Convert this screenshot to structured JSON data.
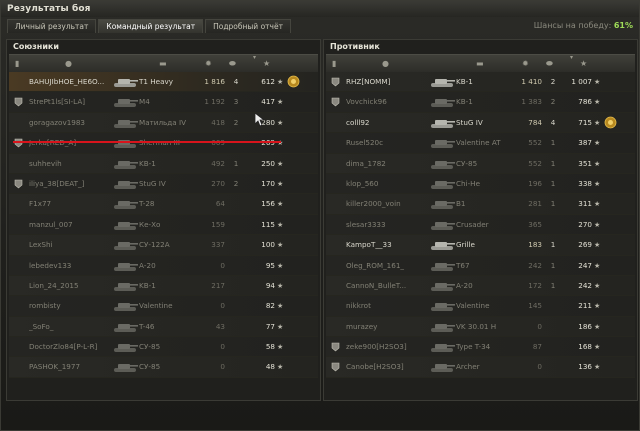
{
  "window": {
    "title": "Результаты боя"
  },
  "tabs": [
    {
      "label": "Личный результат",
      "active": false
    },
    {
      "label": "Командный результат",
      "active": true
    },
    {
      "label": "Подробный отчёт",
      "active": false
    }
  ],
  "win_chance": {
    "label": "Шансы на победу:",
    "value": "61%"
  },
  "colors": {
    "accent_green": "#9fdc58",
    "highlight_line": "#d8141c",
    "player_row": "#4a3a23"
  },
  "allies": {
    "title": "Союзники",
    "header_icons": [
      "platoon-icon",
      "player-icon",
      "tank-icon",
      "damage-icon",
      "kills-icon",
      "xp-star-icon"
    ],
    "rows": [
      {
        "name": "BAHUJIbHOE_HE6O...",
        "tank": "T1 Heavy",
        "damage": "1 816",
        "kills": "4",
        "xp": "612",
        "alive": true,
        "badge": false,
        "medal": true,
        "player": true
      },
      {
        "name": "StrePt1ls[SI-LA]",
        "tank": "M4",
        "damage": "1 192",
        "kills": "3",
        "xp": "417",
        "alive": false,
        "badge": true,
        "medal": false,
        "player": false
      },
      {
        "name": "goragazov1983",
        "tank": "Матильда IV",
        "damage": "418",
        "kills": "2",
        "xp": "280",
        "alive": false,
        "badge": false,
        "medal": false,
        "player": false
      },
      {
        "name": "Jerka[RED_A]",
        "tank": "Sherman III",
        "damage": "609",
        "kills": "",
        "xp": "269",
        "alive": false,
        "badge": true,
        "medal": false,
        "player": false
      },
      {
        "name": "suhhevih",
        "tank": "KB-1",
        "damage": "492",
        "kills": "1",
        "xp": "250",
        "alive": false,
        "badge": false,
        "medal": false,
        "player": false
      },
      {
        "name": "iliya_38[DEAT_]",
        "tank": "StuG IV",
        "damage": "270",
        "kills": "2",
        "xp": "170",
        "alive": false,
        "badge": true,
        "medal": false,
        "player": false
      },
      {
        "name": "F1x77",
        "tank": "T-28",
        "damage": "64",
        "kills": "",
        "xp": "156",
        "alive": false,
        "badge": false,
        "medal": false,
        "player": false
      },
      {
        "name": "manzul_007",
        "tank": "Ке-Хо",
        "damage": "159",
        "kills": "",
        "xp": "115",
        "alive": false,
        "badge": false,
        "medal": false,
        "player": false
      },
      {
        "name": "LexShi",
        "tank": "СУ-122А",
        "damage": "337",
        "kills": "",
        "xp": "100",
        "alive": false,
        "badge": false,
        "medal": false,
        "player": false
      },
      {
        "name": "lebedev133",
        "tank": "А-20",
        "damage": "0",
        "kills": "",
        "xp": "95",
        "alive": false,
        "badge": false,
        "medal": false,
        "player": false
      },
      {
        "name": "Lion_24_2015",
        "tank": "KB-1",
        "damage": "217",
        "kills": "",
        "xp": "94",
        "alive": false,
        "badge": false,
        "medal": false,
        "player": false
      },
      {
        "name": "rombisty",
        "tank": "Valentine",
        "damage": "0",
        "kills": "",
        "xp": "82",
        "alive": false,
        "badge": false,
        "medal": false,
        "player": false
      },
      {
        "name": "_SoFo_",
        "tank": "T-46",
        "damage": "43",
        "kills": "",
        "xp": "77",
        "alive": false,
        "badge": false,
        "medal": false,
        "player": false
      },
      {
        "name": "DoctorZlo84[P-L-R]",
        "tank": "СУ-85",
        "damage": "0",
        "kills": "",
        "xp": "58",
        "alive": false,
        "badge": false,
        "medal": false,
        "player": false
      },
      {
        "name": "PASHOK_1977",
        "tank": "СУ-85",
        "damage": "0",
        "kills": "",
        "xp": "48",
        "alive": false,
        "badge": false,
        "medal": false,
        "player": false
      }
    ]
  },
  "enemies": {
    "title": "Противник",
    "rows": [
      {
        "name": "RHZ[NOMM]",
        "tank": "KB-1",
        "damage": "1 410",
        "kills": "2",
        "xp": "1 007",
        "alive": true,
        "badge": true,
        "medal": false
      },
      {
        "name": "Vovchick96",
        "tank": "KB-1",
        "damage": "1 383",
        "kills": "2",
        "xp": "786",
        "alive": false,
        "badge": true,
        "medal": false
      },
      {
        "name": "colll92",
        "tank": "StuG IV",
        "damage": "784",
        "kills": "4",
        "xp": "715",
        "alive": true,
        "badge": false,
        "medal": true
      },
      {
        "name": "Rusel520c",
        "tank": "Valentine AT",
        "damage": "552",
        "kills": "1",
        "xp": "387",
        "alive": false,
        "badge": false,
        "medal": false
      },
      {
        "name": "dima_1782",
        "tank": "СУ-85",
        "damage": "552",
        "kills": "1",
        "xp": "351",
        "alive": false,
        "badge": false,
        "medal": false
      },
      {
        "name": "klop_560",
        "tank": "Chi-He",
        "damage": "196",
        "kills": "1",
        "xp": "338",
        "alive": false,
        "badge": false,
        "medal": false
      },
      {
        "name": "killer2000_voin",
        "tank": "B1",
        "damage": "281",
        "kills": "1",
        "xp": "311",
        "alive": false,
        "badge": false,
        "medal": false
      },
      {
        "name": "slesar3333",
        "tank": "Crusader",
        "damage": "365",
        "kills": "",
        "xp": "270",
        "alive": false,
        "badge": false,
        "medal": false
      },
      {
        "name": "KampoT__33",
        "tank": "Grille",
        "damage": "183",
        "kills": "1",
        "xp": "269",
        "alive": true,
        "badge": false,
        "medal": false
      },
      {
        "name": "Oleg_ROM_161_",
        "tank": "T67",
        "damage": "242",
        "kills": "1",
        "xp": "247",
        "alive": false,
        "badge": false,
        "medal": false
      },
      {
        "name": "CannoN_BulleT...",
        "tank": "А-20",
        "damage": "172",
        "kills": "1",
        "xp": "242",
        "alive": false,
        "badge": false,
        "medal": false
      },
      {
        "name": "nikkrot",
        "tank": "Valentine",
        "damage": "145",
        "kills": "",
        "xp": "211",
        "alive": false,
        "badge": false,
        "medal": false
      },
      {
        "name": "murazey",
        "tank": "VK 30.01 H",
        "damage": "0",
        "kills": "",
        "xp": "186",
        "alive": false,
        "badge": false,
        "medal": false
      },
      {
        "name": "zeke900[H2SO3]",
        "tank": "Type T-34",
        "damage": "87",
        "kills": "",
        "xp": "168",
        "alive": false,
        "badge": true,
        "medal": false
      },
      {
        "name": "Canobe[H2SO3]",
        "tank": "Archer",
        "damage": "0",
        "kills": "",
        "xp": "136",
        "alive": false,
        "badge": true,
        "medal": false
      }
    ]
  }
}
